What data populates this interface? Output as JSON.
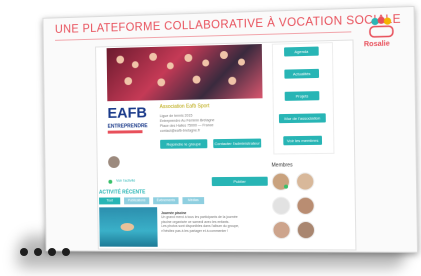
{
  "slide": {
    "title": "UNE PLATEFORME COLLABORATIVE À VOCATION SOCIALE",
    "brand": "Rosalie"
  },
  "org": {
    "logo_text": "EAFB",
    "logo_subtitle": "ENTREPRENDRE",
    "title": "Association Eafb Sport",
    "info_lines": [
      "Ligue de tennis 2015",
      "Entreprendre Au Féminin Bretagne",
      "Place des Halles 75000 — France",
      "contact@eafb-bretagne.fr"
    ]
  },
  "buttons": {
    "join": "Rejoindre le groupe",
    "contact": "Contacter l'administrateur",
    "side": [
      "Agenda",
      "Actualités",
      "Projets",
      "Mur de l'association",
      "Voir les membres"
    ],
    "publish": "Publier"
  },
  "feed": {
    "recent_link": "Voir l'activité",
    "activity_heading": "ACTIVITÉ RÉCENTE",
    "tabs": [
      "Tout",
      "Publications",
      "Événements",
      "Médias"
    ],
    "post_title": "Journée piscine",
    "post_lines": [
      "Un grand merci à tous les participants de la journée",
      "piscine organisée ce samedi avec les enfants.",
      "Les photos sont disponibles dans l'album du groupe,",
      "n'hésitez pas à les partager et à commenter !"
    ]
  },
  "members": {
    "heading": "Membres"
  },
  "colors": {
    "accent": "#e8505b",
    "teal": "#28b5b5",
    "org_blue": "#1a3a8a"
  }
}
